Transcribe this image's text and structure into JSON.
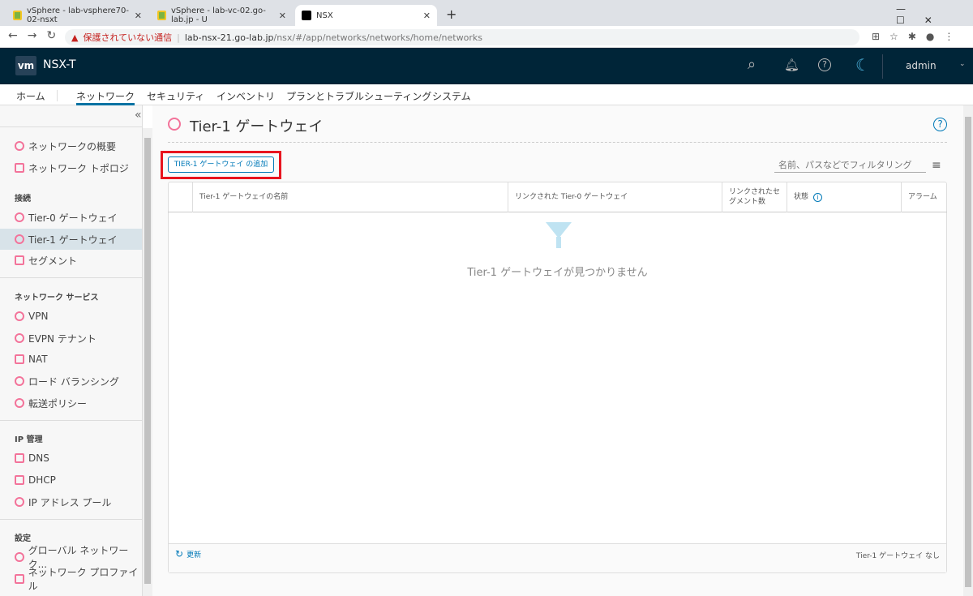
{
  "browser": {
    "tabs": [
      {
        "title": "vSphere - lab-vsphere70-02-nsxt"
      },
      {
        "title": "vSphere - lab-vc-02.go-lab.jp - U"
      },
      {
        "title": "NSX"
      }
    ],
    "new_tab": "+",
    "close": "✕",
    "security_warning": "保護されていない通信",
    "url_host": "lab-nsx-21.go-lab.jp",
    "url_path": "/nsx/#/app/networks/networks/home/networks"
  },
  "header": {
    "logo": "vm",
    "product": "NSX-T",
    "user": "admin"
  },
  "nav": {
    "items": [
      "ホーム",
      "ネットワーク",
      "セキュリティ",
      "インベントリ",
      "プランとトラブルシューティング",
      "システム"
    ],
    "active": 1
  },
  "sidebar": {
    "collapse": "«",
    "items": [
      {
        "label": "ネットワークの概要",
        "icon": "dashboard-icon"
      },
      {
        "label": "ネットワーク トポロジ",
        "icon": "topology-icon"
      },
      {
        "section": "接続"
      },
      {
        "label": "Tier-0 ゲートウェイ",
        "icon": "gateway-icon"
      },
      {
        "label": "Tier-1 ゲートウェイ",
        "icon": "gateway-icon",
        "selected": true
      },
      {
        "label": "セグメント",
        "icon": "segment-icon"
      },
      {
        "section": "ネットワーク サービス"
      },
      {
        "label": "VPN",
        "icon": "vpn-icon"
      },
      {
        "label": "EVPN テナント",
        "icon": "evpn-icon"
      },
      {
        "label": "NAT",
        "icon": "nat-icon"
      },
      {
        "label": "ロード バランシング",
        "icon": "load-balancer-icon"
      },
      {
        "label": "転送ポリシー",
        "icon": "forwarding-icon"
      },
      {
        "section": "IP 管理"
      },
      {
        "label": "DNS",
        "icon": "dns-icon"
      },
      {
        "label": "DHCP",
        "icon": "dhcp-icon"
      },
      {
        "label": "IP アドレス プール",
        "icon": "ip-pool-icon"
      },
      {
        "section": "設定"
      },
      {
        "label": "グローバル ネットワーク...",
        "icon": "global-network-icon"
      },
      {
        "label": "ネットワーク プロファイル",
        "icon": "profile-icon"
      }
    ]
  },
  "page": {
    "title": "Tier-1 ゲートウェイ",
    "add_button": "TIER-1 ゲートウェイ の追加",
    "filter_placeholder": "名前、パスなどでフィルタリング",
    "columns": [
      "Tier-1 ゲートウェイの名前",
      "リンクされた Tier-0 ゲートウェイ",
      "リンクされたセグメント数",
      "状態",
      "アラーム"
    ],
    "empty": "Tier-1 ゲートウェイが見つかりません",
    "refresh": "更新",
    "count": "Tier-1 ゲートウェイ なし"
  },
  "colors": {
    "header": "#002538",
    "accent": "#0072a3",
    "highlight_box": "#e8141f",
    "icon": "#f3739a"
  }
}
